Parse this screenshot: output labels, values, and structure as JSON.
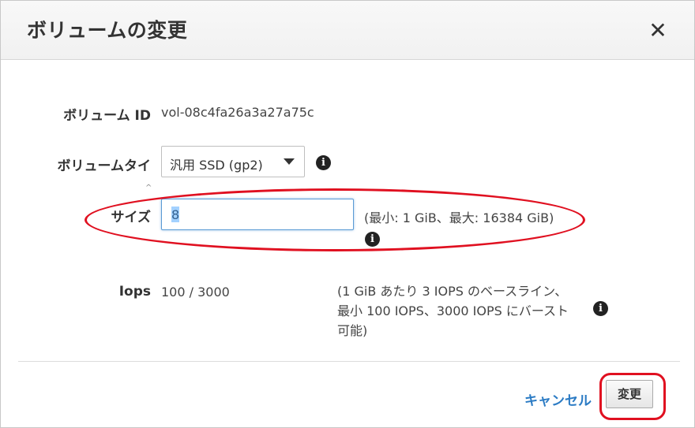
{
  "dialog": {
    "title": "ボリュームの変更",
    "close_glyph": "✕"
  },
  "volume_id": {
    "label": "ボリューム ID",
    "value": "vol-08c4fa26a3a27a75c"
  },
  "volume_type": {
    "label": "ボリュームタイ",
    "selected": "汎用 SSD (gp2)",
    "info_icon": "info-icon"
  },
  "size": {
    "label": "サイズ",
    "value": "8",
    "hint": "(最小: 1 GiB、最大: 16384 GiB)",
    "info_icon": "info-icon"
  },
  "iops": {
    "label": "Iops",
    "value": "100 / 3000",
    "description": "(1 GiB あたり 3 IOPS のベースライン、最小 100 IOPS、3000 IOPS にバースト可能)",
    "info_icon": "info-icon"
  },
  "footer": {
    "cancel_label": "キャンセル",
    "submit_label": "変更"
  },
  "colors": {
    "annotation_red": "#e01020",
    "link_blue": "#2b7bc4",
    "focus_blue": "#5b9bd5"
  }
}
